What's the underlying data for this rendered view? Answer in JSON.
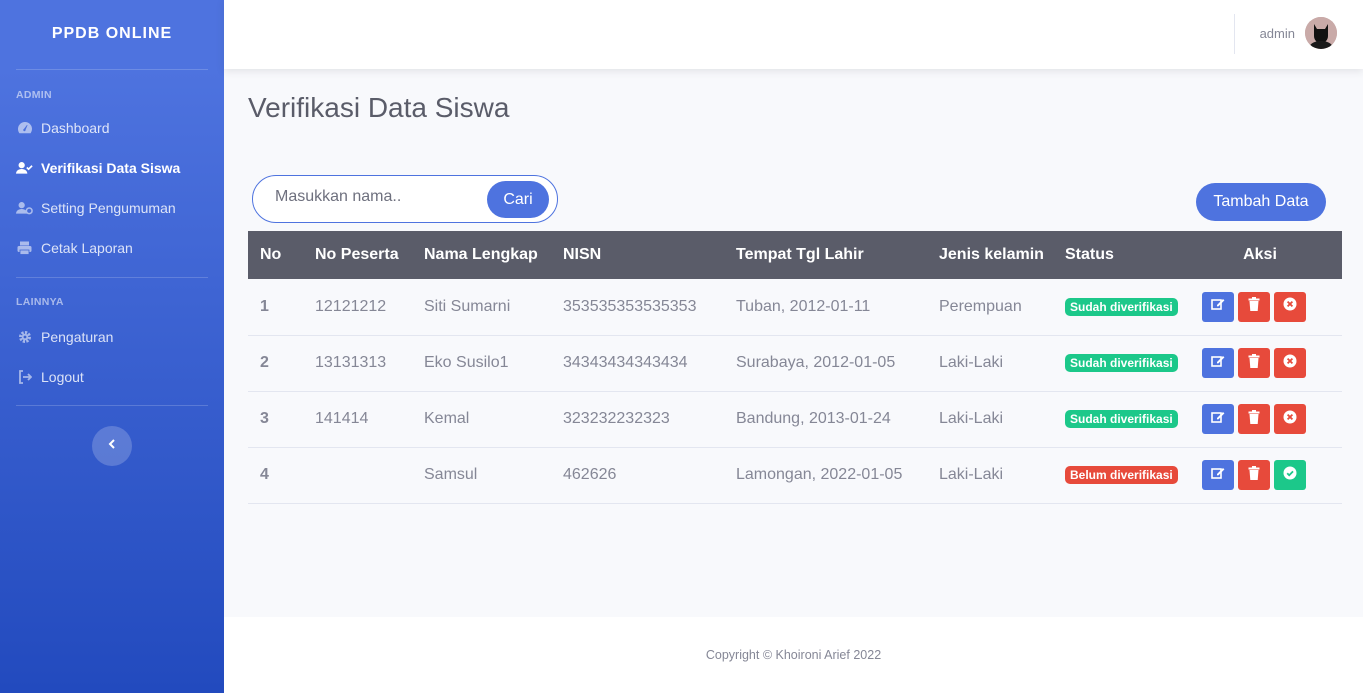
{
  "sidebar": {
    "brand": "PPDB ONLINE",
    "section_admin": "ADMIN",
    "section_other": "LAINNYA",
    "items_admin": [
      {
        "label": "Dashboard",
        "icon": "tachometer-icon"
      },
      {
        "label": "Verifikasi Data Siswa",
        "icon": "user-check-icon",
        "active": true
      },
      {
        "label": "Setting Pengumuman",
        "icon": "users-cog-icon"
      },
      {
        "label": "Cetak Laporan",
        "icon": "print-icon"
      }
    ],
    "items_other": [
      {
        "label": "Pengaturan",
        "icon": "gear-icon"
      },
      {
        "label": "Logout",
        "icon": "logout-icon"
      }
    ]
  },
  "topbar": {
    "username": "admin"
  },
  "page": {
    "title": "Verifikasi Data Siswa",
    "search_placeholder": "Masukkan nama..",
    "search_button": "Cari",
    "add_button": "Tambah Data"
  },
  "table": {
    "columns": [
      "No",
      "No Peserta",
      "Nama Lengkap",
      "NISN",
      "Tempat Tgl Lahir",
      "Jenis kelamin",
      "Status",
      "Aksi"
    ],
    "rows": [
      {
        "no": "1",
        "no_peserta": "12121212",
        "nama": "Siti Sumarni",
        "nisn": "353535353535353",
        "ttl": "Tuban, 2012-01-11",
        "jk": "Perempuan",
        "status": "Sudah diverifikasi",
        "verified": true
      },
      {
        "no": "2",
        "no_peserta": "13131313",
        "nama": "Eko Susilo1",
        "nisn": "34343434343434",
        "ttl": "Surabaya, 2012-01-05",
        "jk": "Laki-Laki",
        "status": "Sudah diverifikasi",
        "verified": true
      },
      {
        "no": "3",
        "no_peserta": "141414",
        "nama": "Kemal",
        "nisn": "323232232323",
        "ttl": "Bandung, 2013-01-24",
        "jk": "Laki-Laki",
        "status": "Sudah diverifikasi",
        "verified": true
      },
      {
        "no": "4",
        "no_peserta": "",
        "nama": "Samsul",
        "nisn": "462626",
        "ttl": "Lamongan, 2022-01-05",
        "jk": "Laki-Laki",
        "status": "Belum diverifikasi",
        "verified": false
      }
    ]
  },
  "footer": {
    "text": "Copyright © Khoironi Arief 2022"
  },
  "colors": {
    "primary": "#4e73df",
    "success": "#1cc88a",
    "danger": "#e74a3b",
    "dark": "#5a5c69"
  }
}
